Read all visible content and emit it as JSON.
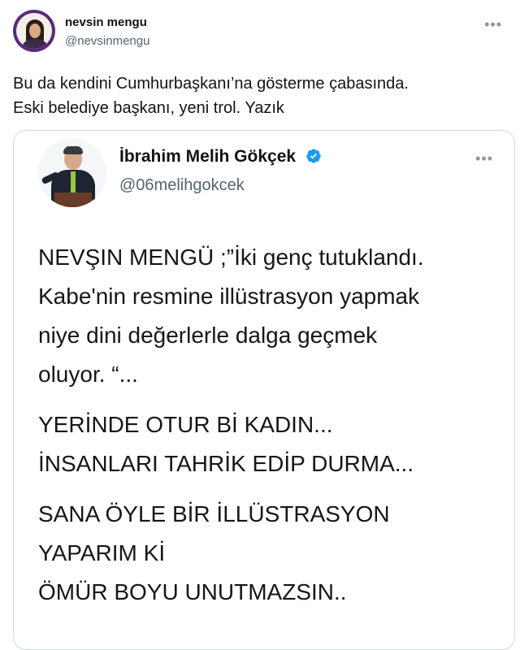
{
  "tweet": {
    "author_name": "nevsin mengu",
    "author_handle": "@nevsinmengu",
    "more_icon": "more-horizontal-icon",
    "text_lines": [
      "Bu da kendini Cumhurbaşkanı’na gösterme çabasında.",
      "Eski belediye başkanı, yeni trol. Yazık"
    ]
  },
  "quoted_tweet": {
    "author_name": "İbrahim Melih Gökçek",
    "verified_icon": "verified-badge-icon",
    "verified_color": "#1d9bf0",
    "author_handle": "@06melihgokcek",
    "more_icon": "more-horizontal-icon",
    "paragraphs": [
      [
        "NEVŞIN MENGÜ ;”İki genç tutuklandı.",
        "Kabe'nin resmine illüstrasyon yapmak",
        "niye dini değerlerle dalga geçmek",
        "oluyor. “..."
      ],
      [
        "YERİNDE OTUR Bİ KADIN...",
        "İNSANLARI TAHRİK EDİP DURMA..."
      ],
      [
        "SANA ÖYLE BİR İLLÜSTRASYON",
        "YAPARIM Kİ",
        "ÖMÜR BOYU UNUTMAZSIN.."
      ]
    ]
  },
  "colors": {
    "text_primary": "#0f1419",
    "text_secondary": "#536471",
    "border": "#cfd9de",
    "avatar_ring": "#5a2a7a"
  }
}
